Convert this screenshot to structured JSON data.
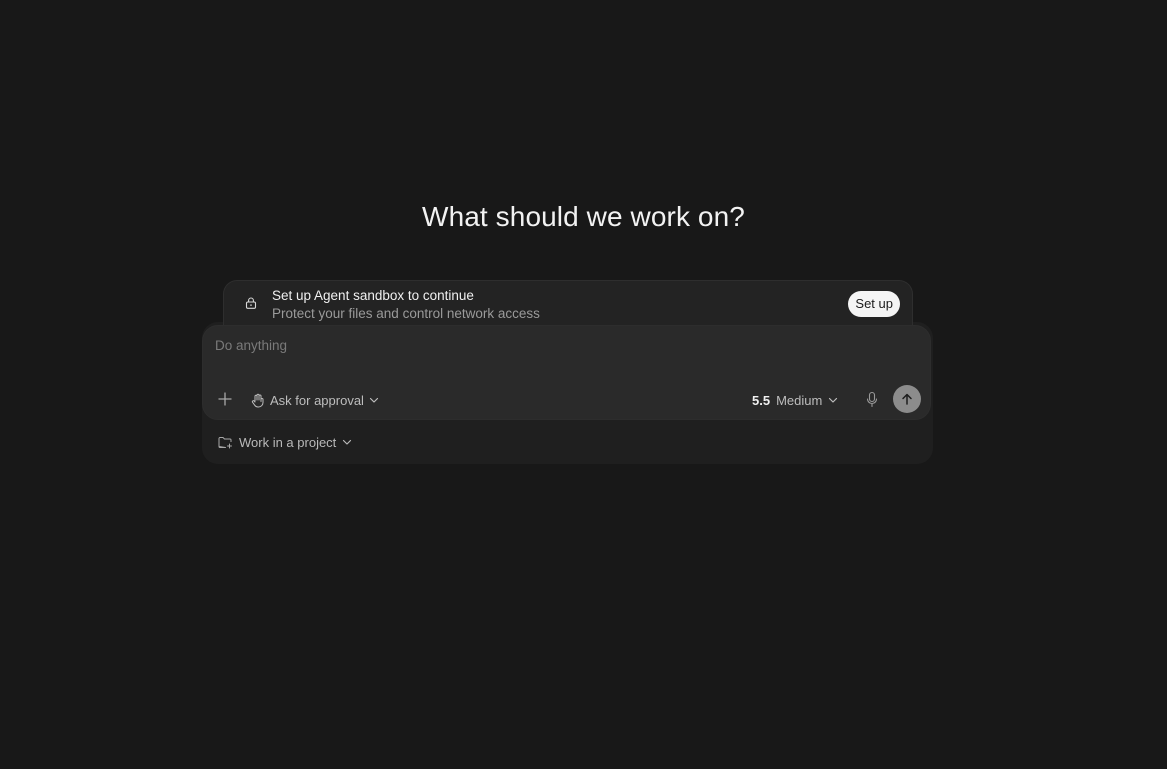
{
  "heading": "What should we work on?",
  "banner": {
    "title": "Set up Agent sandbox to continue",
    "subtitle": "Protect your files and control network access",
    "button_label": "Set up",
    "icon": "lock-icon"
  },
  "composer": {
    "placeholder": "Do anything",
    "value": "",
    "approval_label": "Ask for approval",
    "model_version": "5.5",
    "model_effort": "Medium"
  },
  "project": {
    "label": "Work in a project"
  },
  "colors": {
    "background": "#181818",
    "input_bg": "#2a2a2a",
    "send_button": "#8c8c8c",
    "setup_button": "#f5f5f5"
  }
}
